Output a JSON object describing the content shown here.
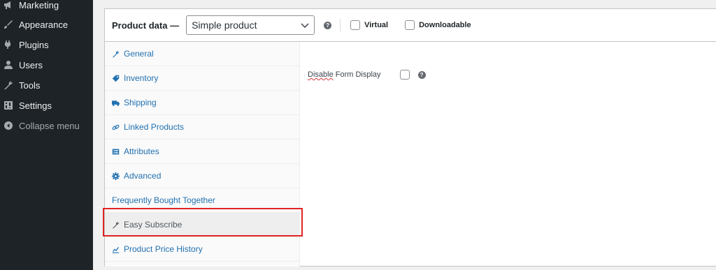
{
  "sidebar": {
    "items": [
      {
        "label": "Marketing",
        "icon": "megaphone-icon"
      },
      {
        "label": "Appearance",
        "icon": "paintbrush-icon"
      },
      {
        "label": "Plugins",
        "icon": "plugin-icon"
      },
      {
        "label": "Users",
        "icon": "users-icon"
      },
      {
        "label": "Tools",
        "icon": "wrench-icon"
      },
      {
        "label": "Settings",
        "icon": "settings-icon"
      },
      {
        "label": "Collapse menu",
        "icon": "collapse-icon"
      }
    ]
  },
  "product_data": {
    "title": "Product data —",
    "product_type": {
      "selected": "Simple product"
    },
    "help_glyph": "?",
    "virtual_label": "Virtual",
    "downloadable_label": "Downloadable",
    "tabs": [
      {
        "label": "General",
        "icon": "wrench-icon"
      },
      {
        "label": "Inventory",
        "icon": "tag-icon"
      },
      {
        "label": "Shipping",
        "icon": "truck-icon"
      },
      {
        "label": "Linked Products",
        "icon": "link-icon"
      },
      {
        "label": "Attributes",
        "icon": "list-icon"
      },
      {
        "label": "Advanced",
        "icon": "gear-icon"
      },
      {
        "label": "Frequently Bought Together",
        "icon": "none"
      },
      {
        "label": "Easy Subscribe",
        "icon": "wrench-icon",
        "active": true
      },
      {
        "label": "Product Price History",
        "icon": "chart-icon"
      }
    ],
    "field": {
      "label_part1": "Disable",
      "label_part2": " Form Display",
      "checked": false
    }
  },
  "colors": {
    "sidebar_bg": "#1d2327",
    "link_blue": "#2271b1",
    "highlight_red": "#e02424"
  }
}
